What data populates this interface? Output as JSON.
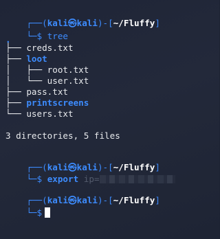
{
  "prompt": {
    "user": "kali",
    "at": "㉿",
    "host": "kali",
    "cwd": "~/Fluffy",
    "top_prefix": "┌──(",
    "top_mid": ")-[",
    "top_suffix": "]",
    "bottom_prefix": "└─$"
  },
  "commands": [
    {
      "cmd": "tree"
    },
    {
      "cmd": "export",
      "args": "ip="
    },
    {
      "cmd": ""
    }
  ],
  "tree_output": {
    "root": ".",
    "entries": [
      {
        "prefix": "├── ",
        "name": "creds.txt",
        "type": "file"
      },
      {
        "prefix": "├── ",
        "name": "loot",
        "type": "dir"
      },
      {
        "prefix": "│   ├── ",
        "name": "root.txt",
        "type": "file"
      },
      {
        "prefix": "│   └── ",
        "name": "user.txt",
        "type": "file"
      },
      {
        "prefix": "├── ",
        "name": "pass.txt",
        "type": "file"
      },
      {
        "prefix": "├── ",
        "name": "printscreens",
        "type": "dir"
      },
      {
        "prefix": "└── ",
        "name": "users.txt",
        "type": "file"
      }
    ],
    "summary": "3 directories, 5 files"
  },
  "colors": {
    "prompt_blue": "#3d8cff",
    "text": "#e8eaed",
    "background": "#1d2333"
  }
}
